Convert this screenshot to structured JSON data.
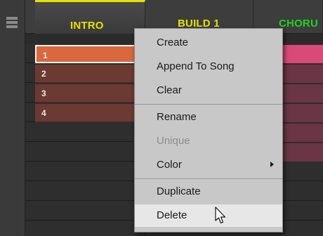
{
  "sections": [
    {
      "label": "INTRO"
    },
    {
      "label": "BUILD 1"
    },
    {
      "label": "CHORU"
    }
  ],
  "patterns": [
    {
      "label": "1"
    },
    {
      "label": "2"
    },
    {
      "label": "3"
    },
    {
      "label": "4"
    }
  ],
  "context_menu": {
    "items": [
      {
        "label": "Create"
      },
      {
        "label": "Append To Song"
      },
      {
        "label": "Clear"
      },
      {
        "label": "Rename"
      },
      {
        "label": "Unique"
      },
      {
        "label": "Color"
      },
      {
        "label": "Duplicate"
      },
      {
        "label": "Delete"
      }
    ]
  },
  "colors": {
    "section_accent": "#e6e000",
    "chorus_accent": "#1fd21f",
    "pattern_active": "#d9683e",
    "pattern_inactive": "#6b3a32",
    "chorus_pattern": "#d94a78"
  }
}
